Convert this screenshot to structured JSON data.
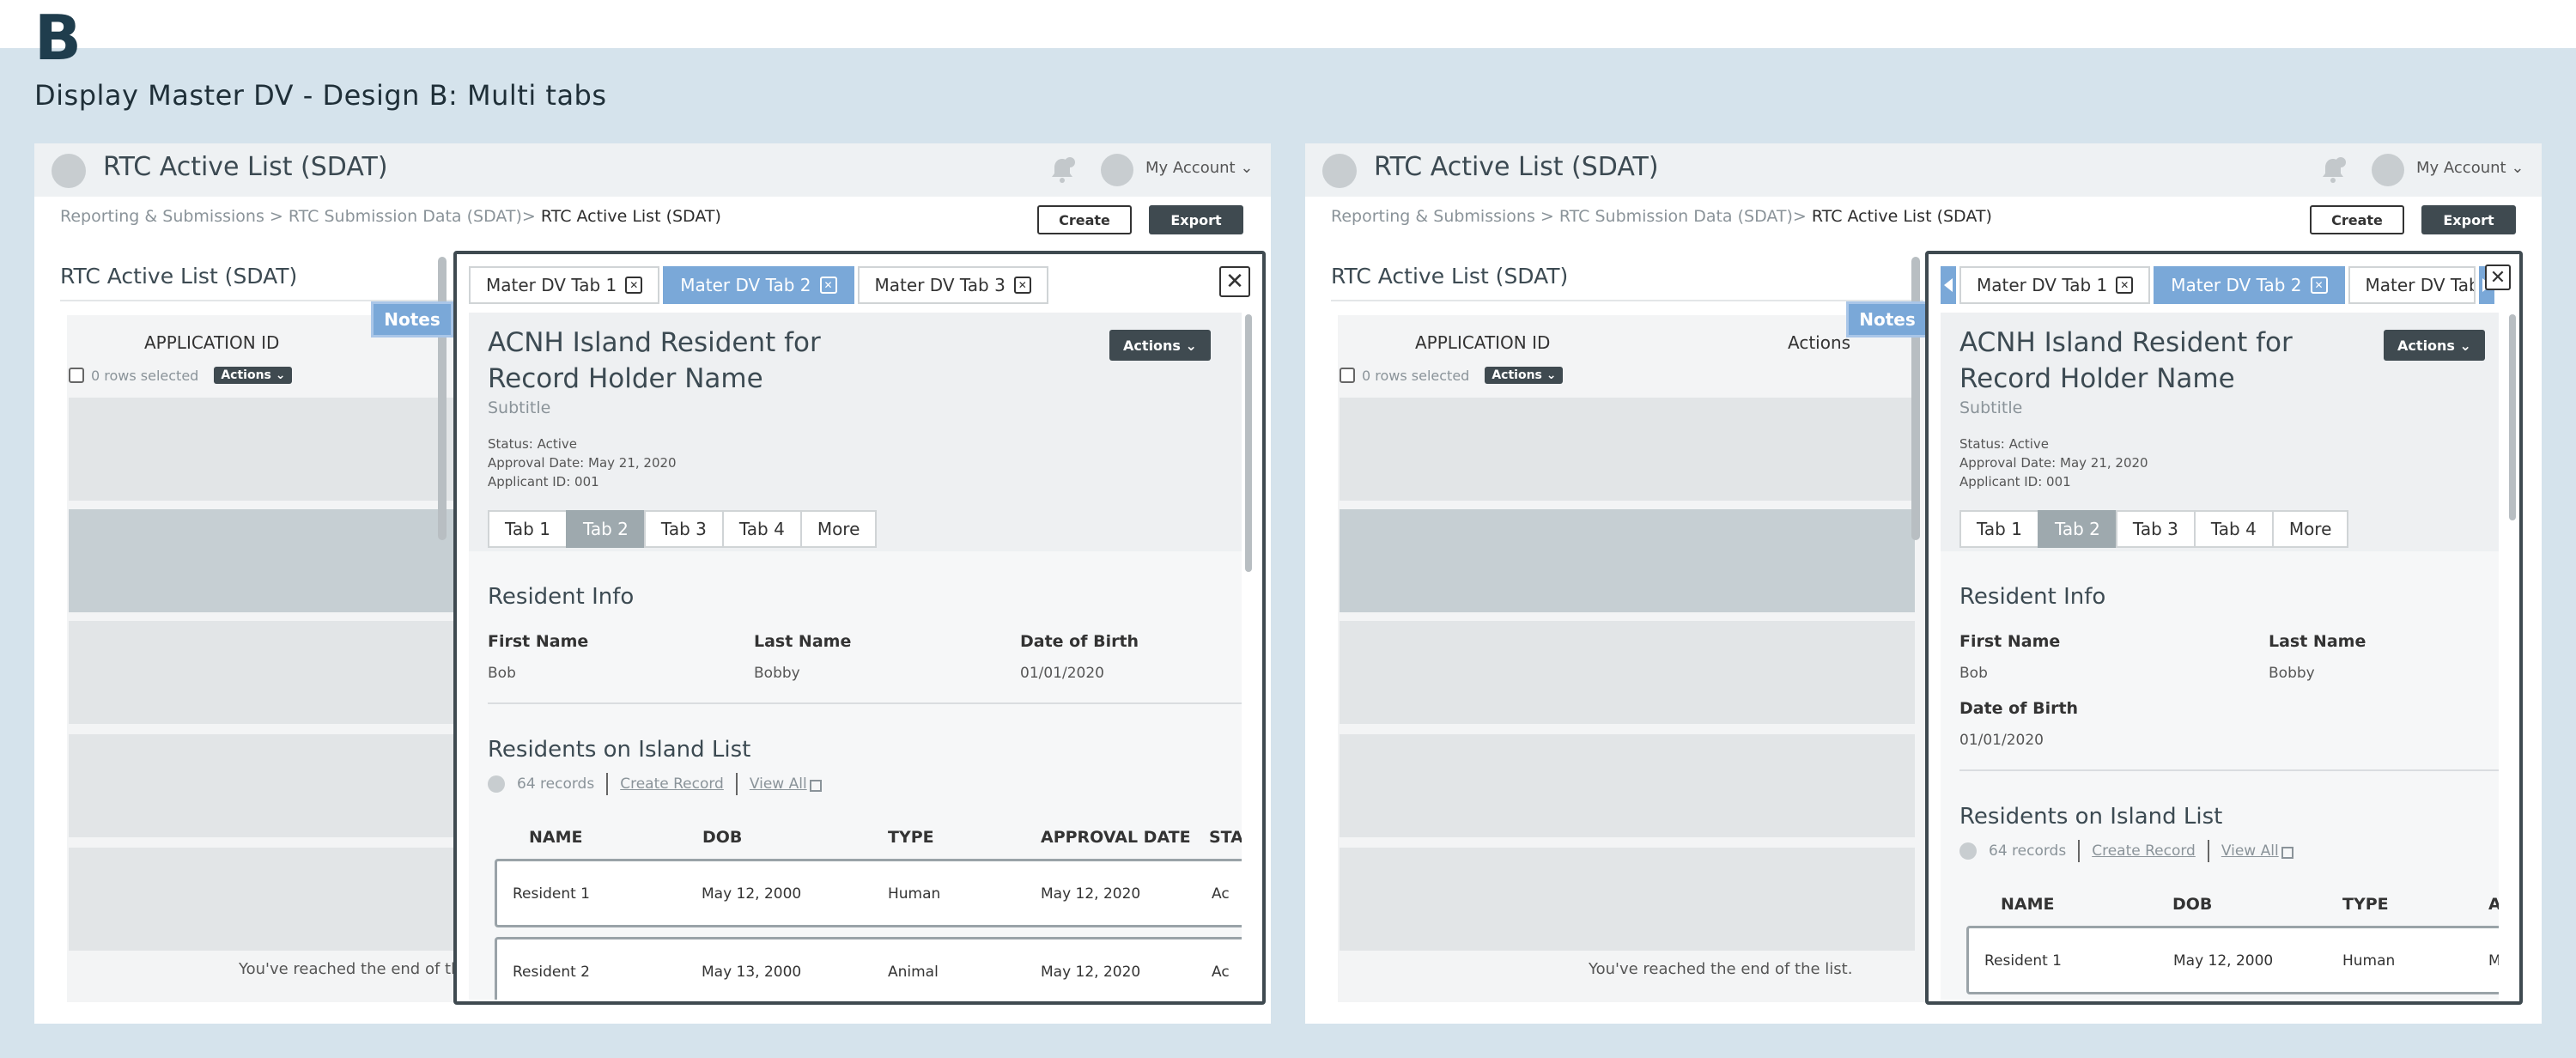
{
  "heading": {
    "letter": "B",
    "title": "Display Master DV - Design B: Multi tabs"
  },
  "app": {
    "title": "RTC Active List (SDAT)",
    "account": "My Account",
    "chevron": "⌄",
    "breadcrumb_prefix": "Reporting & Submissions > RTC Submission Data (SDAT)>",
    "breadcrumb_current": " RTC Active List (SDAT)",
    "create_label": "Create",
    "export_label": "Export"
  },
  "list": {
    "title": "RTC Active List (SDAT)",
    "column_application_id": "APPLICATION ID",
    "column_actions": "Actions",
    "rows_selected": "0 rows selected",
    "actions_label": "Actions ⌄",
    "end_text_left": "You've reached the end of the",
    "end_text_right": "You've reached the end of the list.",
    "notes_label": "Notes"
  },
  "dv_tabs_left": [
    {
      "label": "Mater DV Tab 1",
      "close": "✕"
    },
    {
      "label": "Mater DV Tab 2",
      "close": "✕"
    },
    {
      "label": "Mater DV Tab 3",
      "close": "✕"
    }
  ],
  "dv_tabs_right": [
    {
      "label": "Mater DV Tab 1",
      "close": "✕"
    },
    {
      "label": "Mater DV Tab 2",
      "close": "✕"
    },
    {
      "label": "Mater DV Tab"
    }
  ],
  "dv": {
    "close_label": "✕",
    "title": "ACNH Island Resident for Record Holder Name",
    "subtitle": "Subtitle",
    "status": "Status: Active",
    "approval_date": "Approval Date: May 21, 2020",
    "applicant_id": "Applicant ID: 001",
    "actions_label": "Actions ⌄",
    "subtabs": [
      "Tab 1",
      "Tab 2",
      "Tab 3",
      "Tab 4",
      "More"
    ],
    "resident_info": "Resident Info",
    "fields": {
      "first_name_label": "First Name",
      "first_name": "Bob",
      "last_name_label": "Last Name",
      "last_name": "Bobby",
      "dob_label": "Date of Birth",
      "dob": "01/01/2020"
    },
    "list_title": "Residents on Island List",
    "records": "64 records",
    "create_record": "Create Record",
    "view_all": "View All",
    "columns_left": [
      "NAME",
      "DOB",
      "TYPE",
      "APPROVAL DATE",
      "STA"
    ],
    "columns_right": [
      "NAME",
      "DOB",
      "TYPE",
      "A"
    ],
    "rows": [
      {
        "name": "Resident 1",
        "dob": "May 12, 2000",
        "type": "Human",
        "approval": "May 12, 2020",
        "status_clip": "Ac",
        "status_clip_right": "M"
      },
      {
        "name": "Resident 2",
        "dob": "May 13, 2000",
        "type": "Animal",
        "approval": "May 12, 2020",
        "status_clip": "Ac"
      }
    ]
  },
  "colors": {
    "accent": "#7aa8d8",
    "dark": "#3f4a50",
    "background": "#d5e3ec"
  },
  "icons": [
    "bell-icon",
    "chevron-down-icon",
    "close-icon",
    "external-link-icon",
    "caret-icon"
  ]
}
